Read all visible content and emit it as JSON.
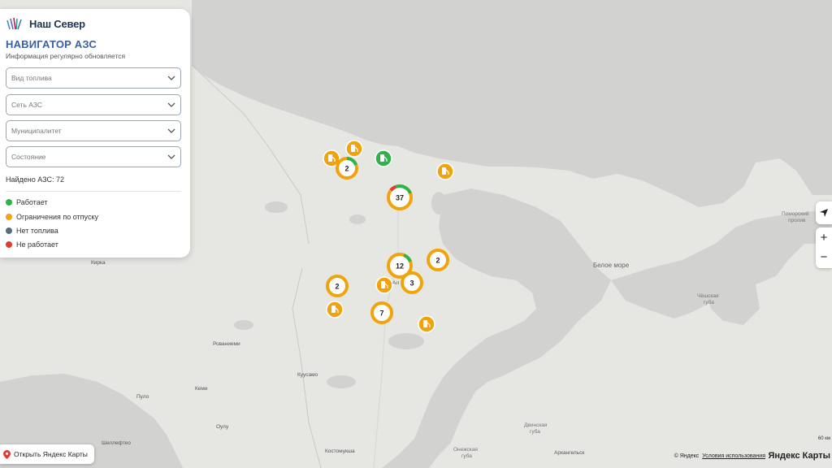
{
  "app": {
    "brand_name": "Наш Север",
    "title": "НАВИГАТОР АЗС",
    "subtitle": "Информация регулярно обновляется"
  },
  "filters": [
    {
      "placeholder": "Вид топлива"
    },
    {
      "placeholder": "Сеть АЗС"
    },
    {
      "placeholder": "Муниципалитет"
    },
    {
      "placeholder": "Состояние"
    }
  ],
  "found_text": "Найдено АЗС: 72",
  "legend": [
    {
      "label": "Работает",
      "color": "#2db34a"
    },
    {
      "label": "Ограничения по отпуску",
      "color": "#f0a30a"
    },
    {
      "label": "Нет топлива",
      "color": "#5a6b7c"
    },
    {
      "label": "Не работает",
      "color": "#e03c31"
    }
  ],
  "map_labels": {
    "beloe_more": "Белое море",
    "pomorsky": "Поморский",
    "proliv": "пролив",
    "cheshskaya": "Чёшская",
    "guba": "губа",
    "dvinskaya": "Двинская",
    "dvinskaya_guba": "губа",
    "onezhskaya": "Онежская",
    "onezhskaya_guba": "губа",
    "kirkenes": "Кирка",
    "rovaniemi": "Рованиеми",
    "kuusamo": "Куусамо",
    "kemi": "Кеми",
    "oulu": "Оулу",
    "shellefteo": "Шеллефтео",
    "kostomuksha": "Костомукша",
    "arkhangelsk": "Архангельск",
    "pulo": "Пуло",
    "kandalaksha": "Ал"
  },
  "clusters": [
    {
      "count": "2",
      "status": "mixed"
    },
    {
      "count": "37",
      "status": "mixed"
    },
    {
      "count": "12",
      "status": "mixed"
    },
    {
      "count": "2",
      "status": "limited"
    },
    {
      "count": "2",
      "status": "limited"
    },
    {
      "count": "3",
      "status": "limited"
    },
    {
      "count": "7",
      "status": "limited"
    }
  ],
  "controls": {
    "zoom_in": "+",
    "zoom_out": "−"
  },
  "open_maps": "Открыть Яндекс Карты",
  "attribution": {
    "copyright": "© Яндекс",
    "terms": "Условия использования",
    "brand": "Яндекс Карты"
  },
  "scale_label": "60 км"
}
